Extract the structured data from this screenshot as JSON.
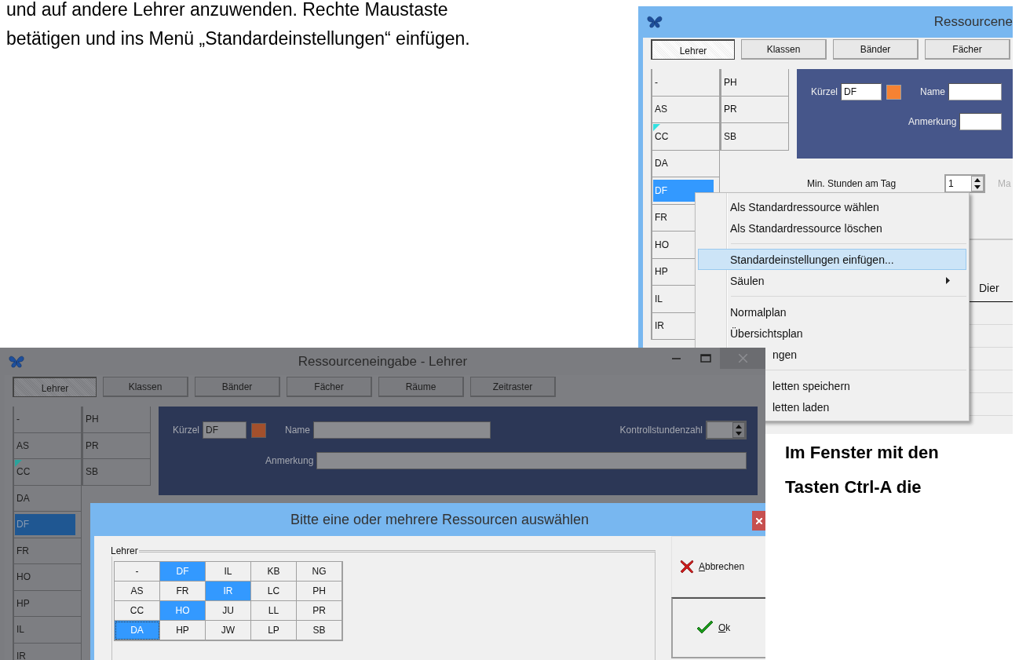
{
  "document": {
    "intro_lines": [
      "und auf andere Lehrer anzuwenden. Rechte Maustaste",
      "betätigen und ins Menü „Standardeinstellungen“ einfügen."
    ],
    "note_lines": [
      "Im Fenster mit den",
      "Tasten Ctrl-A die"
    ]
  },
  "back_window": {
    "dimmed": false,
    "title": "Ressourcene",
    "tabs": [
      {
        "label": "Lehrer",
        "selected": true
      },
      {
        "label": "Klassen",
        "selected": false
      },
      {
        "label": "Bänder",
        "selected": false
      },
      {
        "label": "Fächer",
        "selected": false
      }
    ],
    "list_columns": [
      [
        {
          "label": "-",
          "selected": false,
          "marked": false
        },
        {
          "label": "AS",
          "selected": false,
          "marked": false
        },
        {
          "label": "CC",
          "selected": false,
          "marked": true
        },
        {
          "label": "DA",
          "selected": false,
          "marked": false
        },
        {
          "label": "DF",
          "selected": true,
          "marked": false
        },
        {
          "label": "FR",
          "selected": false,
          "marked": false
        },
        {
          "label": "HO",
          "selected": false,
          "marked": false
        },
        {
          "label": "HP",
          "selected": false,
          "marked": false
        },
        {
          "label": "IL",
          "selected": false,
          "marked": false
        },
        {
          "label": "IR",
          "selected": false,
          "marked": false
        }
      ],
      [
        {
          "label": "PH",
          "selected": false,
          "marked": false
        },
        {
          "label": "PR",
          "selected": false,
          "marked": false
        },
        {
          "label": "SB",
          "selected": false,
          "marked": false
        }
      ]
    ],
    "details": {
      "code_label": "Kürzel",
      "code_value": "DF",
      "name_label": "Name",
      "note_label": "Anmerkung"
    },
    "min_hours": {
      "label": "Min. Stunden am Tag",
      "value": "1",
      "next_label": "Ma"
    },
    "table": {
      "column": "Dier"
    },
    "context_menu": [
      {
        "kind": "item",
        "label": "Als Standardressource wählen",
        "selected": false,
        "submenu": false
      },
      {
        "kind": "item",
        "label": "Als Standardressource löschen",
        "selected": false,
        "submenu": false
      },
      {
        "kind": "separator"
      },
      {
        "kind": "item",
        "label": "Standardeinstellungen einfügen...",
        "selected": true,
        "submenu": false
      },
      {
        "kind": "item",
        "label": "Säulen",
        "selected": false,
        "submenu": true
      },
      {
        "kind": "separator"
      },
      {
        "kind": "item",
        "label": "Normalplan",
        "selected": false,
        "submenu": false
      },
      {
        "kind": "item",
        "label": "Übersichtsplan",
        "selected": false,
        "submenu": false
      },
      {
        "kind": "covered",
        "label": "ngen",
        "selected": false,
        "submenu": false
      },
      {
        "kind": "separator"
      },
      {
        "kind": "covered",
        "label": "letten speichern",
        "selected": false,
        "submenu": false
      },
      {
        "kind": "covered",
        "label": "letten laden",
        "selected": false,
        "submenu": false
      }
    ]
  },
  "front_window": {
    "dimmed": true,
    "title": "Ressourceneingabe - Lehrer",
    "tabs": [
      {
        "label": "Lehrer",
        "selected": true
      },
      {
        "label": "Klassen",
        "selected": false
      },
      {
        "label": "Bänder",
        "selected": false
      },
      {
        "label": "Fächer",
        "selected": false
      },
      {
        "label": "Räume",
        "selected": false
      },
      {
        "label": "Zeitraster",
        "selected": false
      }
    ],
    "list_columns": [
      [
        {
          "label": "-",
          "selected": false,
          "marked": false
        },
        {
          "label": "AS",
          "selected": false,
          "marked": false
        },
        {
          "label": "CC",
          "selected": false,
          "marked": true
        },
        {
          "label": "DA",
          "selected": false,
          "marked": false
        },
        {
          "label": "DF",
          "selected": true,
          "marked": false
        },
        {
          "label": "FR",
          "selected": false,
          "marked": false
        },
        {
          "label": "HO",
          "selected": false,
          "marked": false
        },
        {
          "label": "HP",
          "selected": false,
          "marked": false
        },
        {
          "label": "IL",
          "selected": false,
          "marked": false
        },
        {
          "label": "IR",
          "selected": false,
          "marked": false
        }
      ],
      [
        {
          "label": "PH",
          "selected": false,
          "marked": false
        },
        {
          "label": "PR",
          "selected": false,
          "marked": false
        },
        {
          "label": "SB",
          "selected": false,
          "marked": false
        }
      ]
    ],
    "details": {
      "code_label": "Kürzel",
      "code_value": "DF",
      "name_label": "Name",
      "note_label": "Anmerkung",
      "count_label": "Kontrollstundenzahl"
    }
  },
  "dialog": {
    "title": "Bitte eine oder mehrere Ressourcen auswählen",
    "group_label": "Lehrer",
    "grid": [
      [
        {
          "label": "-",
          "selected": false,
          "focused": false
        },
        {
          "label": "DF",
          "selected": true,
          "focused": false
        },
        {
          "label": "IL",
          "selected": false,
          "focused": false
        },
        {
          "label": "KB",
          "selected": false,
          "focused": false
        },
        {
          "label": "NG",
          "selected": false,
          "focused": false
        }
      ],
      [
        {
          "label": "AS",
          "selected": false,
          "focused": false
        },
        {
          "label": "FR",
          "selected": false,
          "focused": false
        },
        {
          "label": "IR",
          "selected": true,
          "focused": false
        },
        {
          "label": "LC",
          "selected": false,
          "focused": false
        },
        {
          "label": "PH",
          "selected": false,
          "focused": false
        }
      ],
      [
        {
          "label": "CC",
          "selected": false,
          "focused": false
        },
        {
          "label": "HO",
          "selected": true,
          "focused": false
        },
        {
          "label": "JU",
          "selected": false,
          "focused": false
        },
        {
          "label": "LL",
          "selected": false,
          "focused": false
        },
        {
          "label": "PR",
          "selected": false,
          "focused": false
        }
      ],
      [
        {
          "label": "DA",
          "selected": true,
          "focused": true
        },
        {
          "label": "HP",
          "selected": false,
          "focused": false
        },
        {
          "label": "JW",
          "selected": false,
          "focused": false
        },
        {
          "label": "LP",
          "selected": false,
          "focused": false
        },
        {
          "label": "SB",
          "selected": false,
          "focused": false
        }
      ]
    ],
    "buttons": [
      {
        "kind": "cancel",
        "label": "Abbrechen"
      },
      {
        "kind": "ok",
        "label": "Ok"
      }
    ]
  }
}
